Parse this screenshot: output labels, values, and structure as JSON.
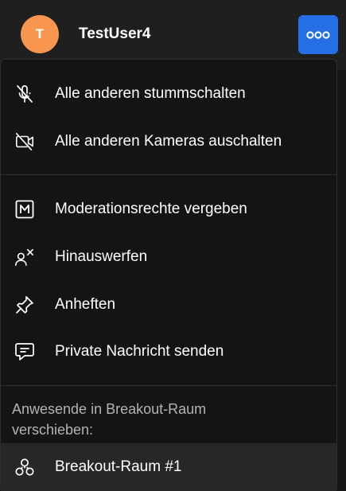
{
  "header": {
    "avatar_initial": "T",
    "avatar_color": "#f8964f",
    "username": "TestUser4",
    "more_button_color": "#246fe5",
    "more_icon": "more-horizontal-icon"
  },
  "menu": {
    "group1": [
      {
        "label": "Alle anderen stummschalten",
        "icon": "microphone-off-icon"
      },
      {
        "label": "Alle anderen Kameras auschalten",
        "icon": "camera-off-icon"
      }
    ],
    "group2": [
      {
        "label": "Moderationsrechte vergeben",
        "icon": "moderator-m-icon"
      },
      {
        "label": "Hinauswerfen",
        "icon": "kick-user-icon"
      },
      {
        "label": "Anheften",
        "icon": "pin-icon"
      },
      {
        "label": "Private Nachricht senden",
        "icon": "message-icon"
      }
    ],
    "breakout_section_label": "Anwesende in Breakout-Raum verschieben:",
    "breakout_rooms": [
      {
        "label": "Breakout-Raum #1",
        "icon": "breakout-room-icon"
      }
    ]
  }
}
